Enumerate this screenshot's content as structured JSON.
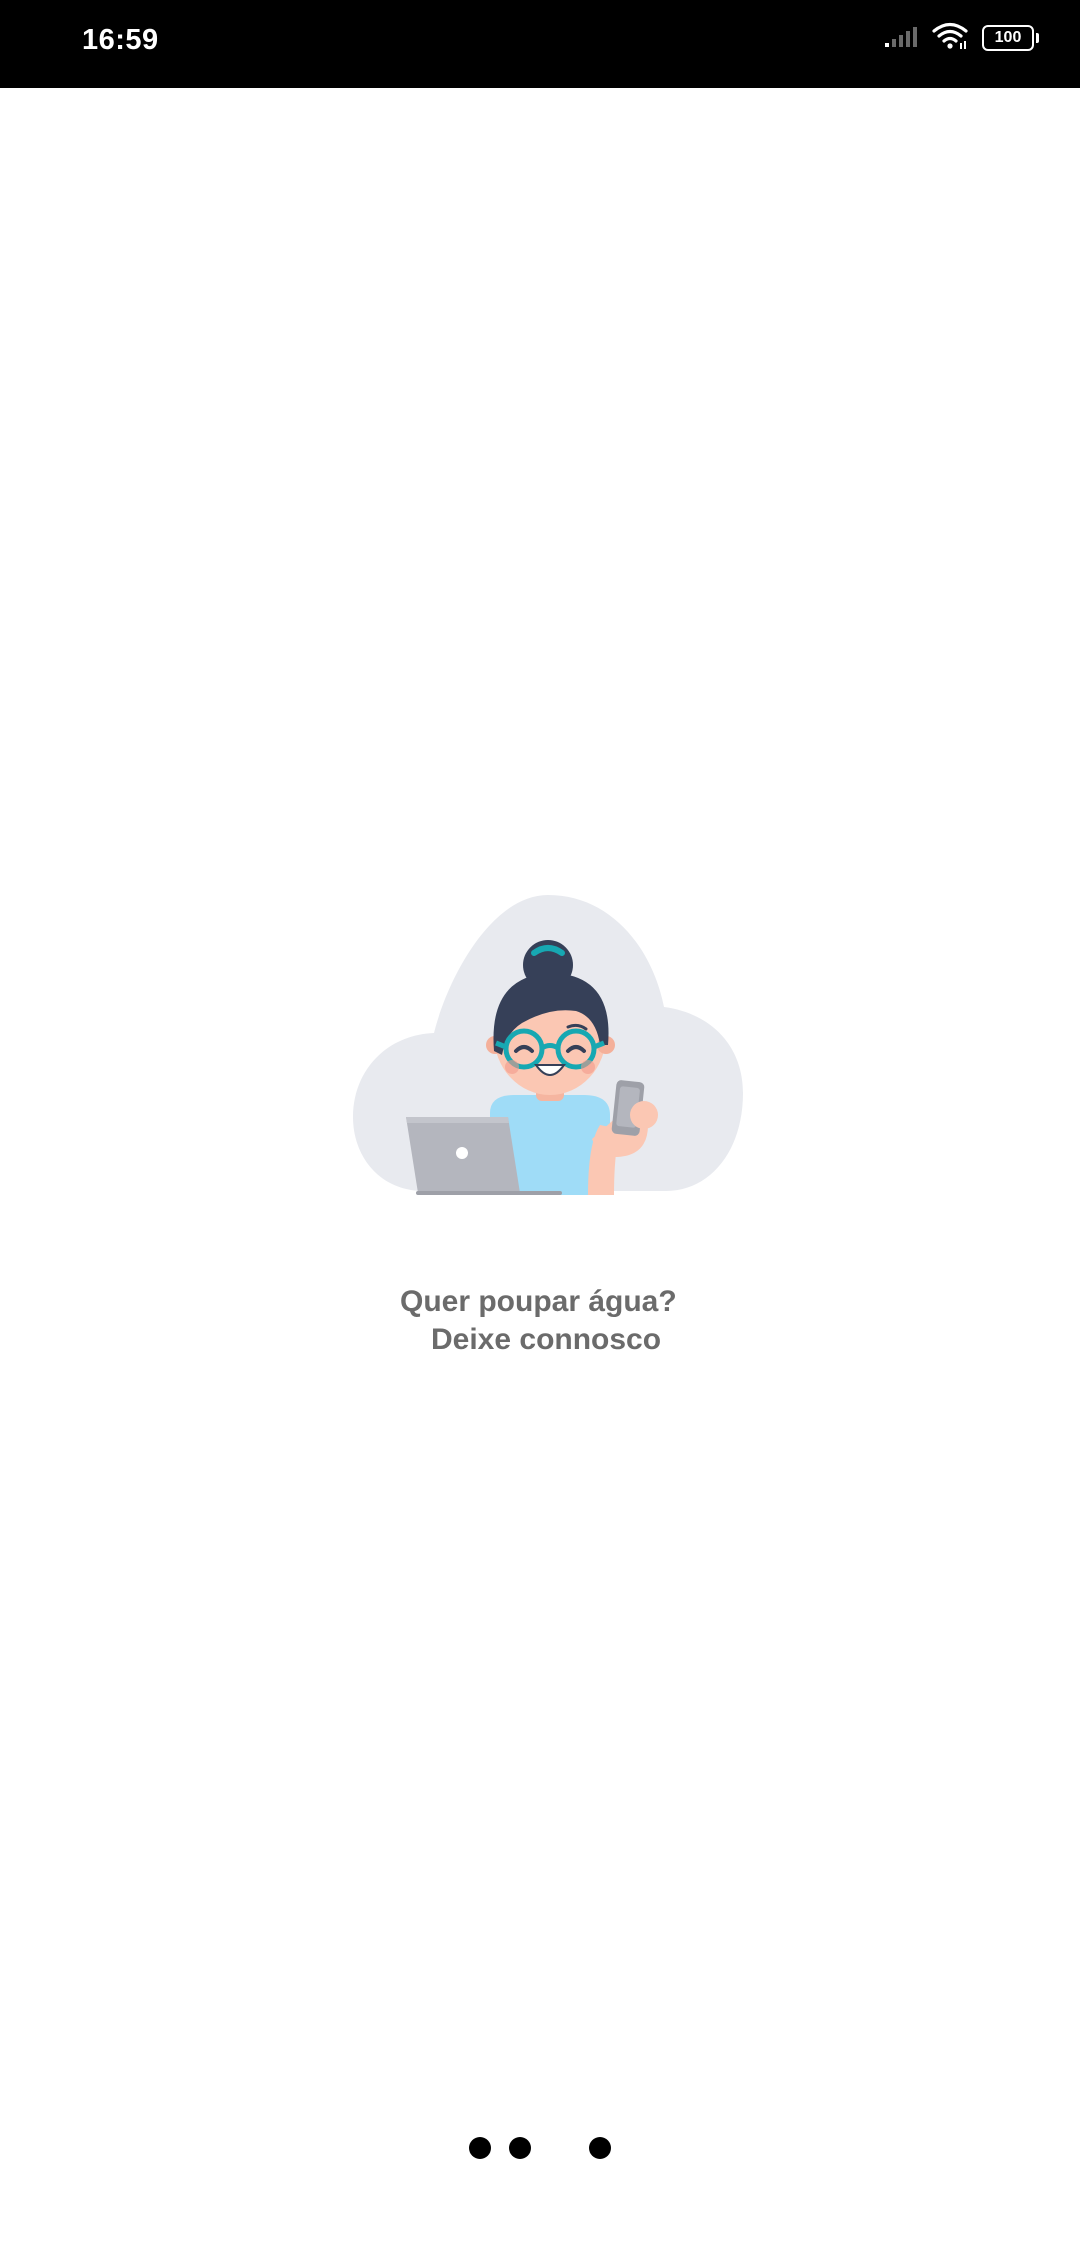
{
  "status_bar": {
    "time": "16:59",
    "battery_level": "100",
    "icons": [
      "signal-icon",
      "wifi-icon",
      "battery-icon"
    ]
  },
  "splash": {
    "illustration": "woman-with-laptop-and-phone-illustration",
    "headline": "Quer poupar água?",
    "subline": "Deixe connosco"
  },
  "loading_indicator": {
    "dots": 3
  },
  "colors": {
    "status_bar_bg": "#000000",
    "background": "#ffffff",
    "text": "#6b6b6b",
    "cloud": "#e8eaef",
    "shirt": "#9fdcf7",
    "hair": "#364058",
    "glasses": "#17a8b2",
    "skin": "#fbc7b3",
    "laptop": "#b4b6be"
  }
}
